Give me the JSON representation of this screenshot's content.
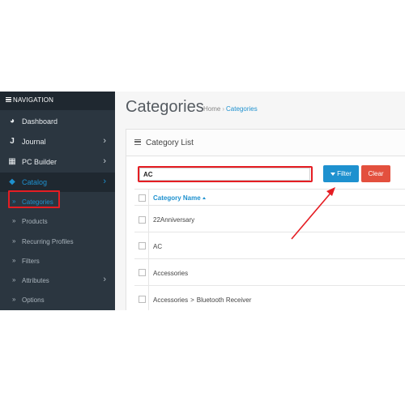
{
  "sidebar": {
    "heading": "NAVIGATION",
    "items": [
      {
        "label": "Dashboard",
        "icon": "dashboard-icon"
      },
      {
        "label": "Journal",
        "icon": "journal-icon"
      },
      {
        "label": "PC Builder",
        "icon": "puzzle-icon"
      },
      {
        "label": "Catalog",
        "icon": "tag-icon"
      }
    ],
    "sub_items": [
      {
        "label": "Categories"
      },
      {
        "label": "Products"
      },
      {
        "label": "Recurring Profiles"
      },
      {
        "label": "Filters"
      },
      {
        "label": "Attributes"
      },
      {
        "label": "Options"
      }
    ]
  },
  "header": {
    "title": "Categories",
    "breadcrumb": {
      "home": "Home",
      "current": "Categories"
    }
  },
  "panel": {
    "title": "Category List",
    "filter_value": "AC",
    "filter_button": "Filter",
    "clear_button": "Clear"
  },
  "table": {
    "column_header": "Category Name",
    "rows": [
      {
        "name": "22Anniversary"
      },
      {
        "name": "AC"
      },
      {
        "name": "Accessories"
      },
      {
        "parent": "Accessories",
        "separator": ">",
        "child": "Bluetooth Receiver"
      }
    ]
  },
  "colors": {
    "sidebar_bg": "#2b3640",
    "accent": "#1e91cf",
    "clear": "#e3503e",
    "highlight": "#e51d23"
  }
}
